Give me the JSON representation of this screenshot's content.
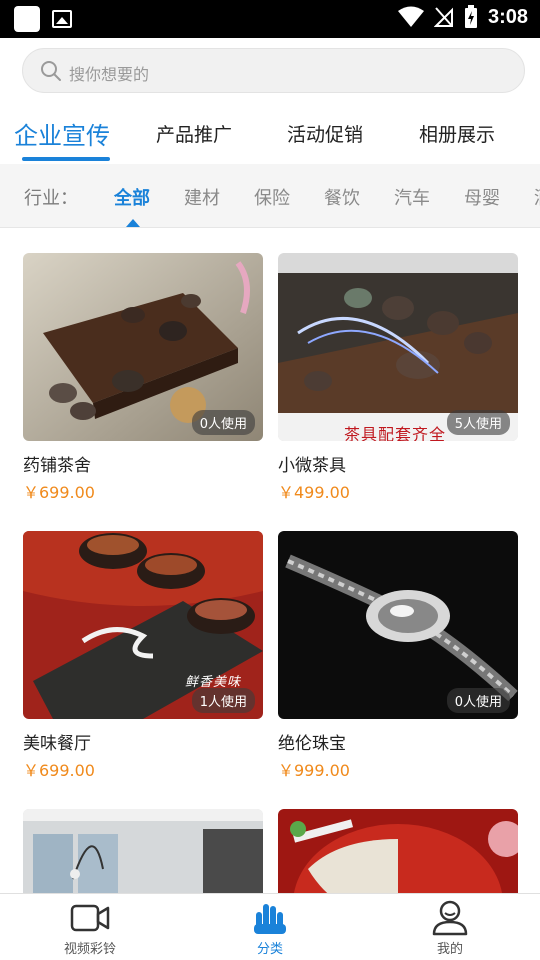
{
  "status_bar": {
    "time": "3:08"
  },
  "search": {
    "placeholder": "搜你想要的"
  },
  "tabs": [
    {
      "label": "企业宣传",
      "active": true
    },
    {
      "label": "产品推广",
      "active": false
    },
    {
      "label": "活动促销",
      "active": false
    },
    {
      "label": "相册展示",
      "active": false
    }
  ],
  "filter": {
    "label": "行业：",
    "chips": [
      "全部",
      "建材",
      "保险",
      "餐饮",
      "汽车",
      "母婴",
      "酒"
    ],
    "active_index": 0
  },
  "cards": [
    {
      "title": "药铺茶舍",
      "price": "￥699.00",
      "usage": "0人使用",
      "image_desc": "tea-tray-photo"
    },
    {
      "title": "小微茶具",
      "price": "￥499.00",
      "usage": "5人使用",
      "image_desc": "tea-set-photo",
      "overlay_text": "茶具配套齐全"
    },
    {
      "title": "美味餐厅",
      "price": "￥699.00",
      "usage": "1人使用",
      "image_desc": "food-bowls-photo",
      "overlay_text": "鲜香美味"
    },
    {
      "title": "绝伦珠宝",
      "price": "￥999.00",
      "usage": "0人使用",
      "image_desc": "jewelry-photo"
    },
    {
      "title": "",
      "price": "",
      "usage": "",
      "image_desc": "interior-photo"
    },
    {
      "title": "",
      "price": "",
      "usage": "",
      "image_desc": "hotpot-photo"
    }
  ],
  "bottom_nav": [
    {
      "label": "视频彩铃",
      "icon": "video-camera-icon",
      "active": false
    },
    {
      "label": "分类",
      "icon": "hand-icon",
      "active": true
    },
    {
      "label": "我的",
      "icon": "user-icon",
      "active": false
    }
  ],
  "colors": {
    "accent": "#1a82d9",
    "price": "#f08a1c"
  }
}
